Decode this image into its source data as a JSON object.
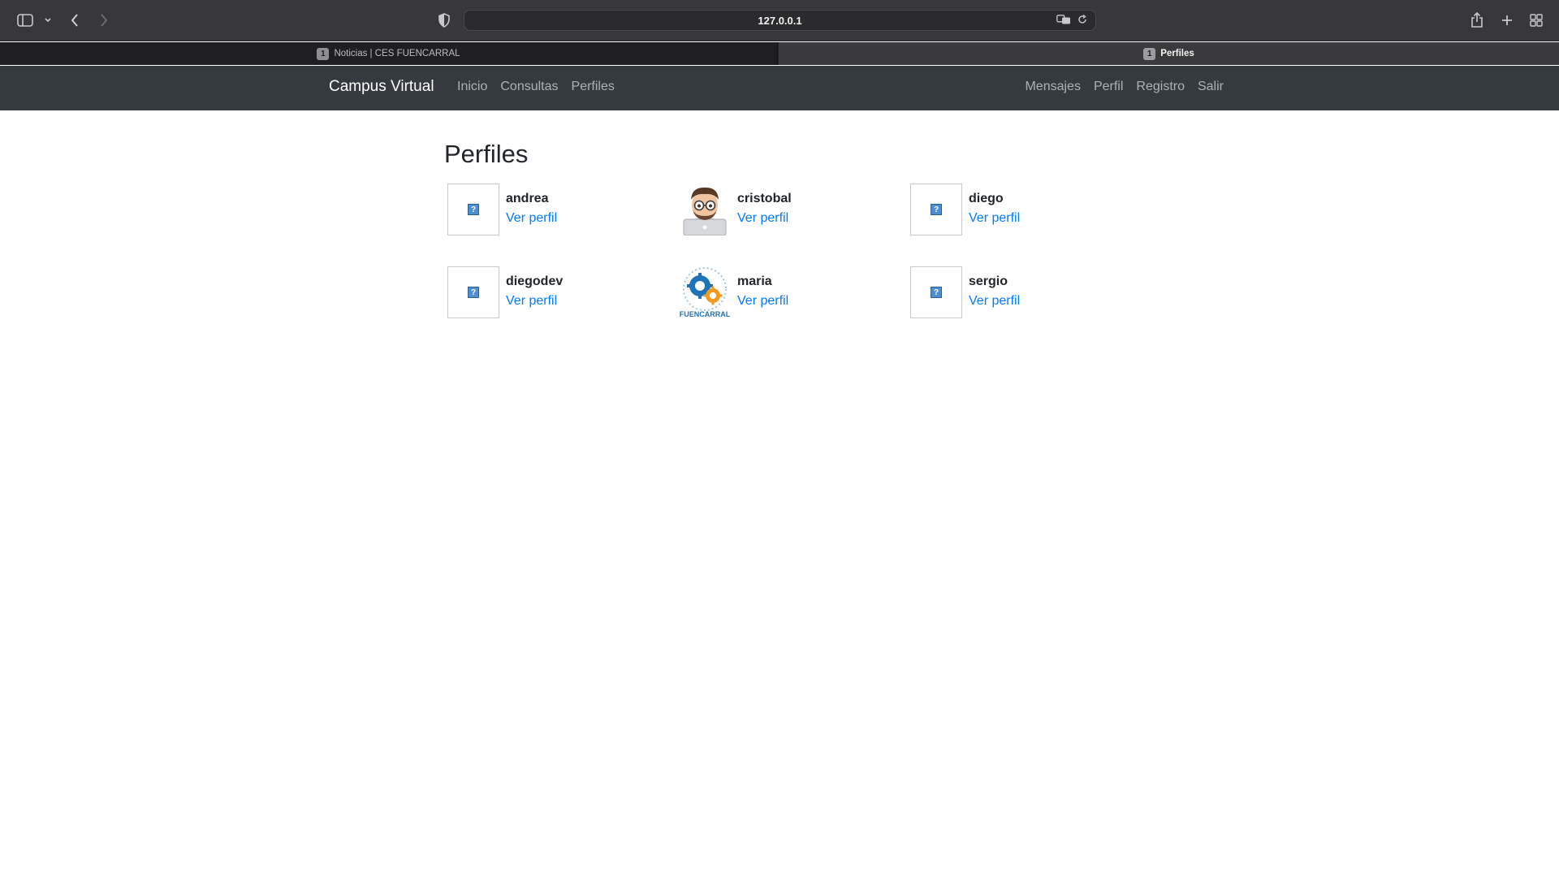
{
  "browser": {
    "url": "127.0.0.1",
    "tabs": [
      {
        "badge": "1",
        "label": "Noticias | CES FUENCARRAL"
      },
      {
        "badge": "1",
        "label": "Perfiles"
      }
    ]
  },
  "navbar": {
    "brand": "Campus Virtual",
    "left_links": [
      "Inicio",
      "Consultas",
      "Perfiles"
    ],
    "right_links": [
      "Mensajes",
      "Perfil",
      "Registro",
      "Salir"
    ]
  },
  "page": {
    "title": "Perfiles",
    "profiles": [
      {
        "username": "andrea",
        "link": "Ver perfil",
        "avatar": "placeholder-image-icon"
      },
      {
        "username": "cristobal",
        "link": "Ver perfil",
        "avatar": "memoji-laptop-avatar"
      },
      {
        "username": "diego",
        "link": "Ver perfil",
        "avatar": "placeholder-image-icon"
      },
      {
        "username": "diegodev",
        "link": "Ver perfil",
        "avatar": "placeholder-image-icon"
      },
      {
        "username": "maria",
        "link": "Ver perfil",
        "avatar": "fuencarral-gears-logo"
      },
      {
        "username": "sergio",
        "link": "Ver perfil",
        "avatar": "placeholder-image-icon"
      }
    ],
    "logo_text": "FUENCARRAL"
  },
  "colors": {
    "navbar_bg": "#343a40",
    "link": "#007bff",
    "logo_blue": "#1f74b6",
    "logo_orange": "#f19a1f"
  }
}
